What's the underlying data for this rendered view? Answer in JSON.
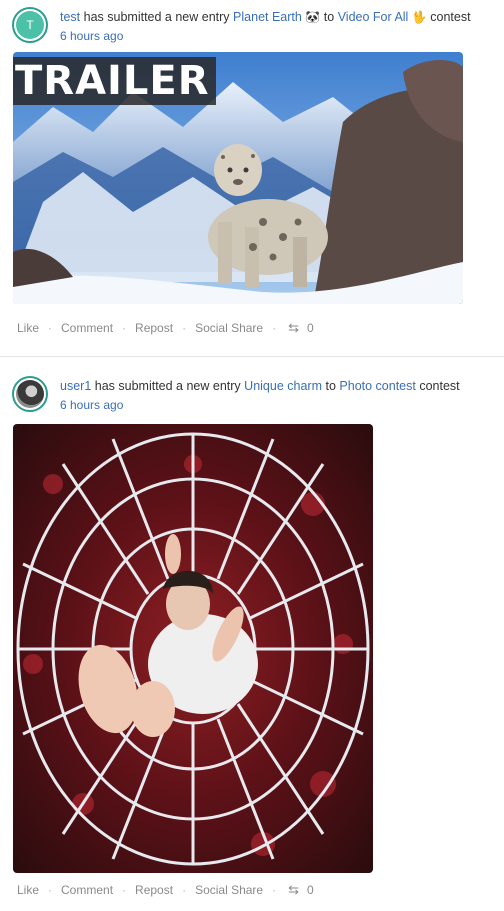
{
  "feed": [
    {
      "user": "test",
      "avatar_initial": "T",
      "avatar_color": "#4cc1a8",
      "action_text": "has submitted a new entry",
      "entry_title": "Planet Earth",
      "entry_emoji": "🐼",
      "to_text": "to",
      "contest_name": "Video For All",
      "contest_emoji": "🖖",
      "suffix": "contest",
      "time": "6 hours ago",
      "media_overlay": "TRAILER",
      "actions": {
        "like": "Like",
        "comment": "Comment",
        "repost": "Repost",
        "social_share": "Social Share",
        "share_count": "0"
      }
    },
    {
      "user": "user1",
      "action_text": "has submitted a new entry",
      "entry_title": "Unique charm",
      "to_text": "to",
      "contest_name": "Photo contest",
      "suffix": "contest",
      "time": "6 hours ago",
      "actions": {
        "like": "Like",
        "comment": "Comment",
        "repost": "Repost",
        "social_share": "Social Share",
        "share_count": "0"
      }
    }
  ]
}
